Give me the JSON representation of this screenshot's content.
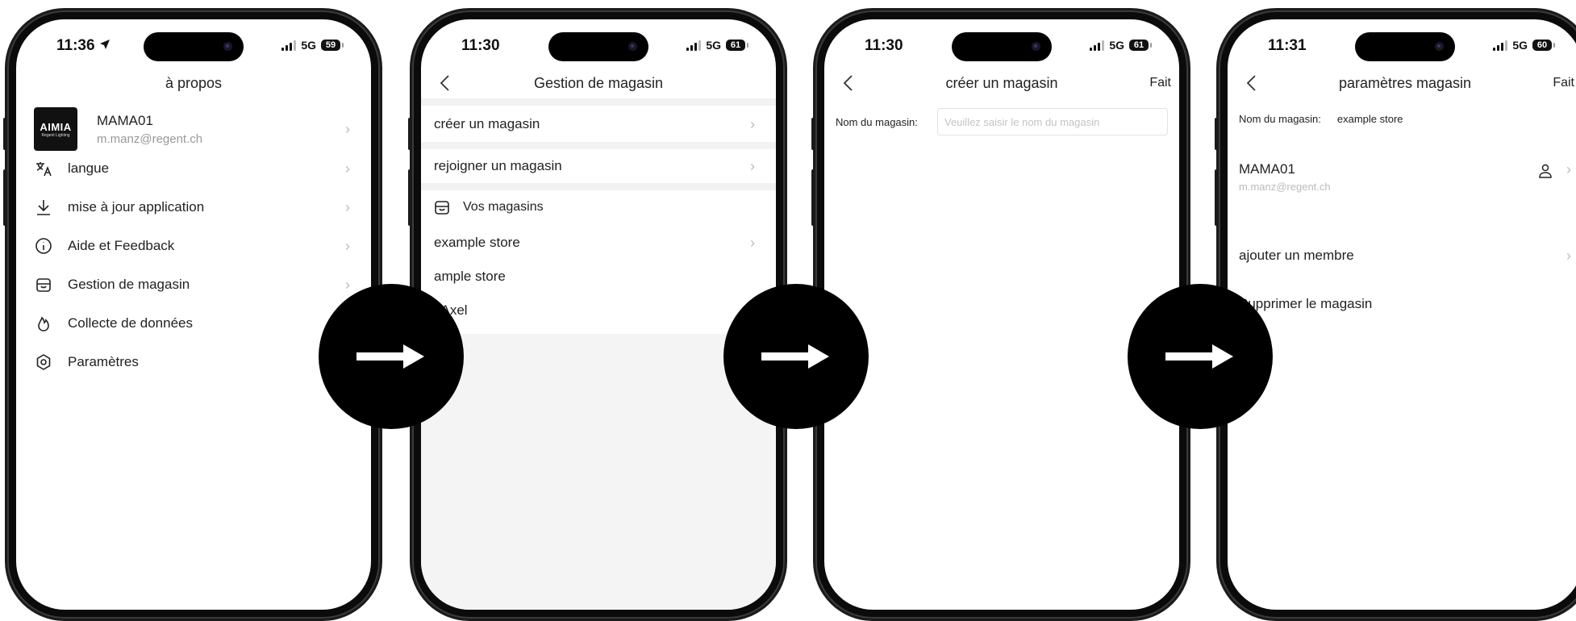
{
  "colors": {
    "background": "#ffffff",
    "phone_frame": "#111111",
    "arrow_circle": "#000000",
    "separator": "#f2f2f2"
  },
  "arrows": [
    {
      "icon": "arrow-right-icon"
    },
    {
      "icon": "arrow-right-icon"
    },
    {
      "icon": "arrow-right-icon"
    }
  ],
  "screen1": {
    "time": "11:36",
    "network": "5G",
    "battery": "59",
    "title": "à propos",
    "profile": {
      "logo_text": "AIMIA",
      "logo_subtext": "Regent Lighting",
      "name": "MAMA01",
      "email": "m.manz@regent.ch"
    },
    "menu": [
      {
        "label": "langue",
        "icon": "translate-icon"
      },
      {
        "label": "mise à jour application",
        "icon": "download-icon"
      },
      {
        "label": "Aide et Feedback",
        "icon": "info-icon"
      },
      {
        "label": "Gestion de magasin",
        "icon": "store-icon"
      },
      {
        "label": "Collecte de données",
        "icon": "flame-icon"
      },
      {
        "label": "Paramètres",
        "icon": "settings-icon"
      }
    ]
  },
  "screen2": {
    "time": "11:30",
    "network": "5G",
    "battery": "61",
    "title": "Gestion de magasin",
    "create": "créer un magasin",
    "join": "rejoigner un magasin",
    "section": "Vos magasins",
    "stores": [
      "example store",
      "ample store",
      "t Axel"
    ]
  },
  "screen3": {
    "time": "11:30",
    "network": "5G",
    "battery": "61",
    "title": "créer un magasin",
    "done": "Fait",
    "field_label": "Nom du magasin:",
    "field_placeholder": "Veuillez saisir le nom du magasin"
  },
  "screen4": {
    "time": "11:31",
    "network": "5G",
    "battery": "60",
    "title": "paramètres magasin",
    "done": "Fait",
    "field_label": "Nom du magasin:",
    "field_value": "example store",
    "member": {
      "name": "MAMA01",
      "email": "m.manz@regent.ch"
    },
    "add_member": "ajouter un membre",
    "delete": "Supprimer le magasin"
  }
}
